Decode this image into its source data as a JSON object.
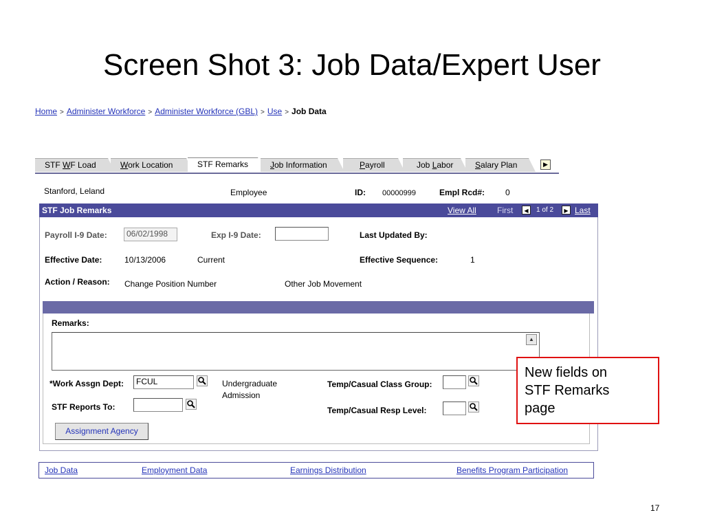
{
  "slide": {
    "title": "Screen Shot 3: Job Data/Expert User",
    "page_number": "17"
  },
  "breadcrumb": {
    "items": [
      "Home",
      "Administer Workforce",
      "Administer Workforce (GBL)",
      "Use"
    ],
    "separator": ">",
    "current": "Job Data"
  },
  "tabs": [
    {
      "pre": "STF ",
      "u": "W",
      "post": "F Load"
    },
    {
      "pre": "",
      "u": "W",
      "post": "ork Location"
    },
    {
      "pre": "STF Remarks",
      "u": "",
      "post": ""
    },
    {
      "pre": "",
      "u": "J",
      "post": "ob Information"
    },
    {
      "pre": "",
      "u": "P",
      "post": "ayroll"
    },
    {
      "pre": "Job ",
      "u": "L",
      "post": "abor"
    },
    {
      "pre": "",
      "u": "S",
      "post": "alary Plan"
    }
  ],
  "employee": {
    "name": "Stanford, Leland",
    "type": "Employee",
    "id_label": "ID:",
    "id_value": "00000999",
    "rcd_label": "Empl Rcd#:",
    "rcd_value": "0"
  },
  "panel": {
    "title": "STF Job Remarks",
    "view_all": "View All",
    "first": "First",
    "count": "1 of 2",
    "last": "Last"
  },
  "form": {
    "payroll_i9_label": "Payroll I-9 Date:",
    "payroll_i9_value": "06/02/1998",
    "exp_i9_label": "Exp I-9 Date:",
    "exp_i9_value": "",
    "last_updated_label": "Last Updated By:",
    "effective_date_label": "Effective Date:",
    "effective_date_value": "10/13/2006",
    "effective_status": "Current",
    "effective_seq_label": "Effective Sequence:",
    "effective_seq_value": "1",
    "action_label": "Action / Reason:",
    "action_value": "Change Position Number",
    "reason_value": "Other Job Movement",
    "remarks_label": "Remarks:",
    "remarks_value": "",
    "work_dept_label": "*Work Assgn Dept:",
    "work_dept_value": "FCUL",
    "work_dept_desc_1": "Undergraduate",
    "work_dept_desc_2": "Admission",
    "reports_to_label": "STF Reports To:",
    "reports_to_value": "",
    "temp_class_label": "Temp/Casual Class Group:",
    "temp_class_value": "",
    "temp_resp_label": "Temp/Casual Resp Level:",
    "temp_resp_value": "",
    "agency_button": "Assignment Agency"
  },
  "callout": {
    "line1": "New fields on",
    "line2": "STF Remarks",
    "line3": "page"
  },
  "bottom_links": [
    "Job Data",
    "Employment Data",
    "Earnings Distribution",
    "Benefits Program Participation"
  ]
}
